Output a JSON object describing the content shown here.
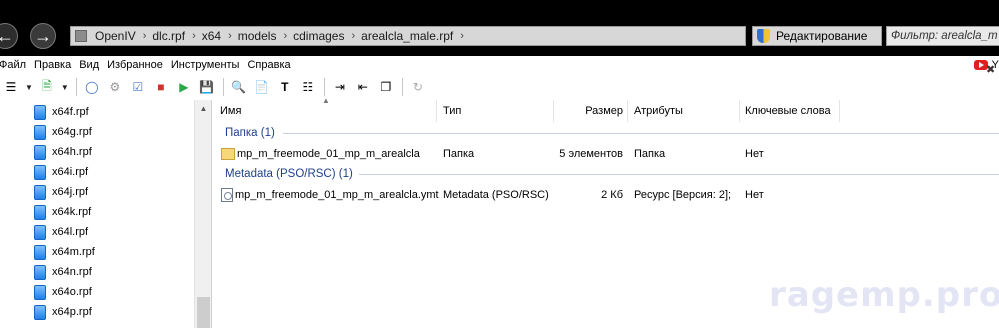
{
  "breadcrumb": [
    "OpenIV",
    "dlc.rpf",
    "x64",
    "models",
    "cdimages",
    "arealcla_male.rpf"
  ],
  "edit_mode_label": "Редактирование",
  "filter_text": "Фильтр: arealcla_m",
  "menu": [
    "Файл",
    "Правка",
    "Вид",
    "Избранное",
    "Инструменты",
    "Справка"
  ],
  "youtube_label": "Y",
  "tree_items": [
    "x64f.rpf",
    "x64g.rpf",
    "x64h.rpf",
    "x64i.rpf",
    "x64j.rpf",
    "x64k.rpf",
    "x64l.rpf",
    "x64m.rpf",
    "x64n.rpf",
    "x64o.rpf",
    "x64p.rpf"
  ],
  "columns": {
    "name": "Имя",
    "type": "Тип",
    "size": "Размер",
    "attributes": "Атрибуты",
    "keywords": "Ключевые слова"
  },
  "groups": [
    {
      "header": "Папка (1)",
      "rows": [
        {
          "icon": "folder-icon",
          "name": "mp_m_freemode_01_mp_m_arealcla",
          "type": "Папка",
          "size": "5 элементов",
          "attributes": "Папка",
          "keywords": "Нет"
        }
      ]
    },
    {
      "header": "Metadata (PSO/RSC) (1)",
      "rows": [
        {
          "icon": "ymt-file-icon",
          "name": "mp_m_freemode_01_mp_m_arealcla.ymt",
          "type": "Metadata (PSO/RSC)",
          "size": "2 Кб",
          "attributes": "Ресурс [Версия: 2];",
          "keywords": "Нет"
        }
      ]
    }
  ],
  "watermark": "ragemp.pro"
}
